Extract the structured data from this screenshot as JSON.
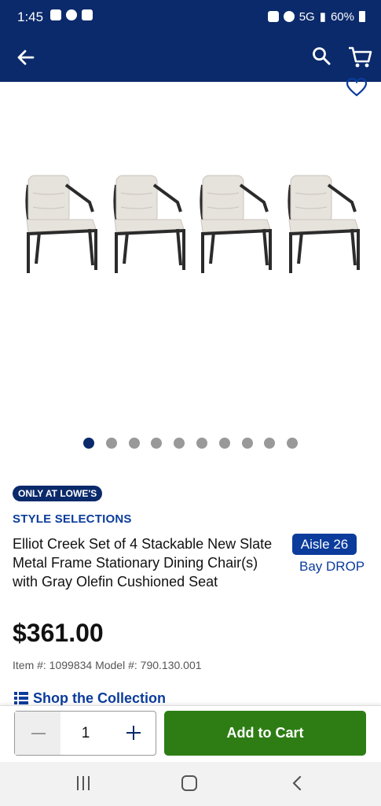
{
  "status_bar": {
    "time": "1:45",
    "battery": "60%",
    "network": "5G"
  },
  "gallery": {
    "image_count": 10,
    "active_index": 0,
    "image_alt": "four gray cushioned dining chairs"
  },
  "product": {
    "badge": "ONLY AT LOWE'S",
    "brand": "STYLE SELECTIONS",
    "title": "Elliot Creek Set of 4 Stackable New Slate Metal Frame Stationary Dining Chair(s) with Gray Olefin Cushioned Seat",
    "aisle": "Aisle 26",
    "bay": "Bay DROP",
    "price": "$361.00",
    "item_line": "Item #: 1099834 Model #: 790.130.001",
    "collection_link": "Shop the Collection"
  },
  "purchase_bar": {
    "quantity": "1",
    "add_to_cart": "Add to Cart"
  },
  "colors": {
    "header_bg": "#0b2a6b",
    "brand_blue": "#0b3c9c",
    "cart_green": "#2e7d14"
  },
  "icons": [
    "back-arrow-icon",
    "search-icon",
    "cart-icon",
    "heart-icon",
    "collection-icon",
    "minus-icon",
    "plus-icon",
    "nav-recents-icon",
    "nav-home-icon",
    "nav-back-icon"
  ]
}
